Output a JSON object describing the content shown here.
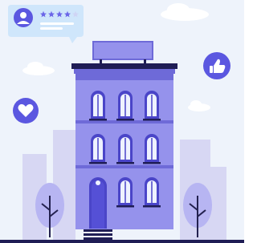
{
  "colors": {
    "sky": "#eef3fb",
    "cloud": "#ffffff",
    "bg_building": "#d7d7f3",
    "building": "#9592ec",
    "building_dark": "#6e6ad8",
    "roof": "#1f1d55",
    "window_frame": "#4a45c8",
    "window_glass": "#eef2ff",
    "door": "#5550d6",
    "tree": "#b7b5f2",
    "trunk": "#23214f",
    "accent": "#5b57e0",
    "star": "#6b66e8",
    "star_empty": "#cfd4f4",
    "ground": "#1f1d55"
  },
  "review_card": {
    "avatar_icon": "user-avatar-icon",
    "rating": 4,
    "max_rating": 5
  },
  "badges": {
    "thumbs_icon": "thumbs-up-icon",
    "heart_icon": "heart-icon"
  }
}
